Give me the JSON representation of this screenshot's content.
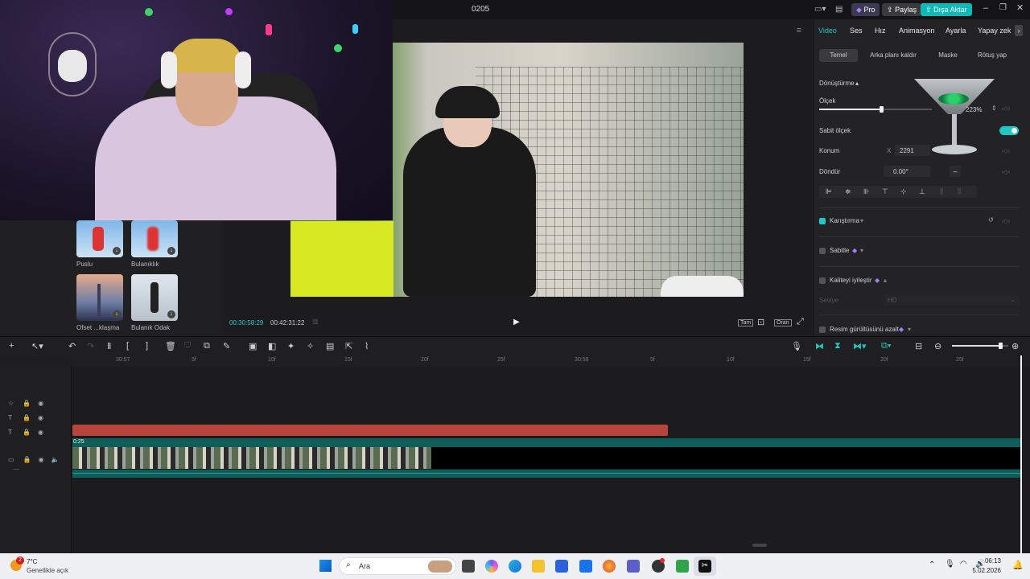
{
  "window": {
    "title": "0205",
    "pro_label": "Pro",
    "share_label": "Paylaş",
    "export_label": "Dışa Aktar"
  },
  "left_panel": {
    "effects": [
      {
        "label": "Puslu"
      },
      {
        "label": "Bulanıklık"
      },
      {
        "label": "Ofset ...klaşma"
      },
      {
        "label": "Bulanık Odak"
      }
    ]
  },
  "viewer": {
    "current_time": "00:30:58:29",
    "total_time": "00:42:31:22",
    "full_label": "Tam",
    "ratio_label": "Oran"
  },
  "inspector": {
    "tabs": [
      "Video",
      "Ses",
      "Hız",
      "Animasyon",
      "Ayarla",
      "Yapay zek"
    ],
    "subtabs": [
      "Temel",
      "Arka planı kaldır",
      "Maske",
      "Rötuş yap"
    ],
    "transform_label": "Dönüştürme",
    "scale_label": "Ölçek",
    "scale_value": "223%",
    "scale_fraction": 0.55,
    "uniform_scale_label": "Sabit ölçek",
    "position_label": "Konum",
    "position_x_prefix": "X",
    "position_x": "2291",
    "rotate_label": "Döndür",
    "rotate_value": "0.00°",
    "blend_label": "Karıştırma",
    "stabilize_label": "Sabitle",
    "enhance_label": "Kaliteyi iyileştir",
    "level_label": "Seviye",
    "level_value": "HD",
    "denoise_label": "Resim gürültüsünü azalt"
  },
  "timeline": {
    "ruler_ticks": [
      "30:57",
      "5f",
      "10f",
      "15f",
      "20f",
      "25f",
      "30:58",
      "5f",
      "10f",
      "15f",
      "20f",
      "25f"
    ],
    "clip_label": "0:25",
    "zoom_fraction": 0.85
  },
  "taskbar": {
    "weather_temp": "7°C",
    "weather_desc": "Genellikle açık",
    "weather_badge": "2",
    "search_placeholder": "Ara",
    "time": "06:13",
    "date": "5.02.2026"
  },
  "colors": {
    "accent": "#1fc8c8",
    "export_button": "#11b8b8",
    "clip_red": "#b8443d",
    "clip_teal": "#0f5e5a"
  }
}
